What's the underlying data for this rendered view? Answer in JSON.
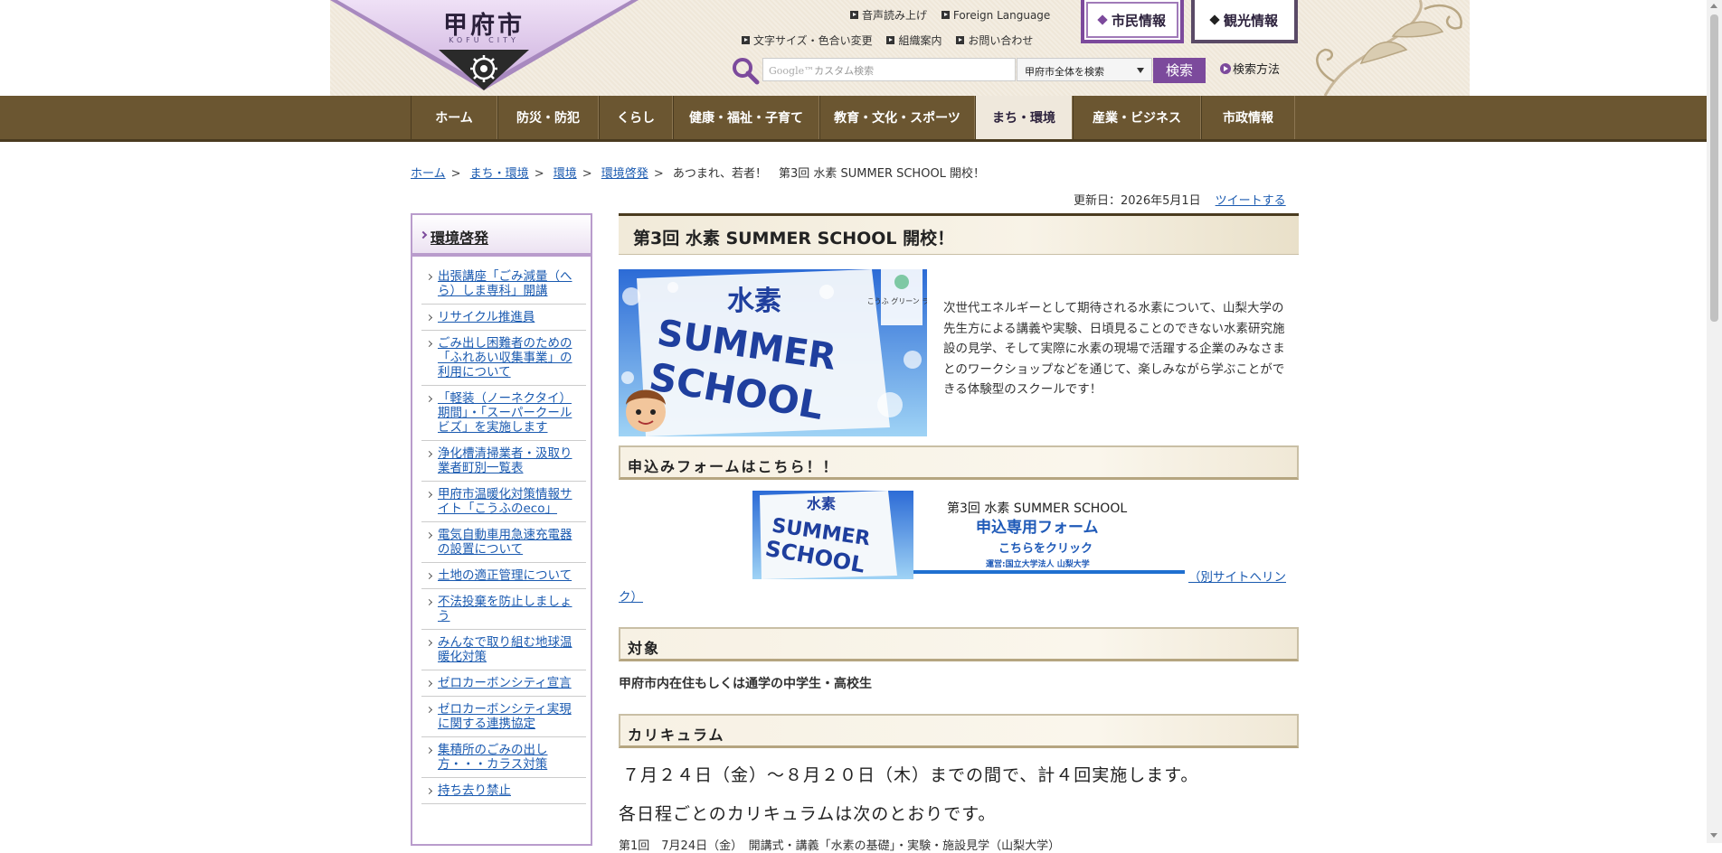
{
  "header": {
    "logo_text": "甲府市",
    "logo_sub": "KOFU CITY",
    "util_row1": [
      {
        "label": "音声読み上げ"
      },
      {
        "label": "Foreign Language"
      }
    ],
    "util_row2": [
      {
        "label": "文字サイズ・色合い変更"
      },
      {
        "label": "組織案内"
      },
      {
        "label": "お問い合わせ"
      }
    ],
    "tab_citizen": "市民情報",
    "tab_tourism": "観光情報",
    "search_placeholder": "カスタム検索",
    "search_brand": "Google™",
    "search_scope": "甲府市全体を検索",
    "search_button": "検索",
    "search_help": "検索方法"
  },
  "gnav": [
    "ホーム",
    "防災・防犯",
    "くらし",
    "健康・福祉・子育て",
    "教育・文化・スポーツ",
    "まち・環境",
    "産業・ビジネス",
    "市政情報"
  ],
  "breadcrumb": {
    "links": [
      "ホーム",
      "まち・環境",
      "環境",
      "環境啓発"
    ],
    "current": "あつまれ、若者！　第3回 水素 SUMMER SCHOOL 開校！"
  },
  "updated": {
    "label": "更新日：2026年5月1日",
    "tweet": "ツイートする"
  },
  "sidebar": {
    "title": "環境啓発",
    "items": [
      "出張講座「ごみ減量（へら）しま専科」開講",
      "リサイクル推進員",
      "ごみ出し困難者のための「ふれあい収集事業」の利用について",
      "「軽装（ノーネクタイ）期間」・「スーパークールビズ」を実施します",
      "浄化槽清掃業者・汲取り業者町別一覧表",
      "甲府市温暖化対策情報サイト「こうふのeco」",
      "電気自動車用急速充電器の設置について",
      "土地の適正管理について",
      "不法投棄を防止しましょう",
      "みんなで取り組む地球温暖化対策",
      "ゼロカーボンシティ宣言",
      "ゼロカーボンシティ実現に関する連携協定",
      "集積所のごみの出し方・・・カラス対策",
      "持ち去り禁止"
    ]
  },
  "main": {
    "title": "第3回 水素 SUMMER SCHOOL 開校！",
    "hero_label_1": "水素",
    "hero_label_2": "SUMMER",
    "hero_label_3": "SCHOOL",
    "hero_badge": "こうふ グリーン ラボ",
    "intro": "次世代エネルギーとして期待される水素について、山梨大学の先生方による講義や実験、日頃見ることのできない水素研究施設の見学、そして実際に水素の現場で活躍する企業のみなさまとのワークショップなどを通じて、楽しみながら学ぶことができる体験型のスクールです！",
    "form_section": "申込みフォームはこちら！！",
    "banner": {
      "line1": "第3回  水素 SUMMER SCHOOL",
      "line2": "申込専用フォーム",
      "line3": "こちらをクリック",
      "line4": "運営:国立大学法人  山梨大学"
    },
    "ext_link_part1": "（別サイトへリン",
    "ext_link_part2": "ク）",
    "target_section": "対象",
    "target_text": "甲府市内在住もしくは通学の中学生・高校生",
    "curriculum_section": "カリキュラム",
    "curriculum_line1": "７月２４日（金）～８月２０日（木）までの間で、計４回実施します。",
    "curriculum_line2": "各日程ごとのカリキュラムは次のとおりです。",
    "curriculum_line3": "第1回　7月24日（金）　開講式・講義「水素の基礎」・実験・施設見学（山梨大学）"
  },
  "colors": {
    "nav_brown": "#6b5631",
    "accent_purple": "#7c4a9c",
    "link_blue": "#1a5ab0"
  }
}
